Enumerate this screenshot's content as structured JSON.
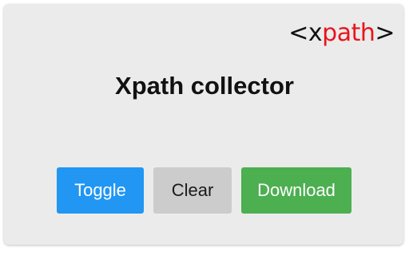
{
  "logo": {
    "open": "<x",
    "accent": "path",
    "close": ">",
    "accent_color": "#e8151b"
  },
  "title": "Xpath collector",
  "buttons": {
    "toggle": "Toggle",
    "clear": "Clear",
    "download": "Download"
  },
  "colors": {
    "toggle": "#2196f3",
    "clear": "#cccccc",
    "download": "#4caf50",
    "panel": "#ebebeb"
  }
}
